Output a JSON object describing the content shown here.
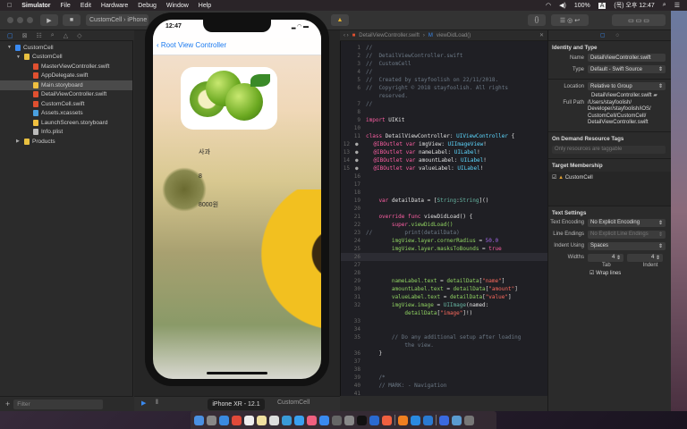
{
  "menubar": {
    "app": "Simulator",
    "items": [
      "File",
      "Edit",
      "Hardware",
      "Debug",
      "Window",
      "Help"
    ],
    "battery": "100%",
    "input_source": "A",
    "clock": "(목) 오후 12:47"
  },
  "toolbar": {
    "scheme": "CustomCell",
    "device": "iPhone"
  },
  "navigator": {
    "items": [
      {
        "label": "CustomCell",
        "icon": "project-icon",
        "indent": 0,
        "disclosure": "▼"
      },
      {
        "label": "CustomCell",
        "icon": "folder-icon",
        "indent": 1,
        "disclosure": "▼"
      },
      {
        "label": "MasterViewController.swift",
        "icon": "swift-file-icon",
        "indent": 2
      },
      {
        "label": "AppDelegate.swift",
        "icon": "swift-file-icon",
        "indent": 2
      },
      {
        "label": "Main.storyboard",
        "icon": "storyboard-icon",
        "indent": 2,
        "selected": true
      },
      {
        "label": "DetailViewController.swift",
        "icon": "swift-file-icon",
        "indent": 2
      },
      {
        "label": "CustomCell.swift",
        "icon": "swift-file-icon",
        "indent": 2
      },
      {
        "label": "Assets.xcassets",
        "icon": "assets-icon",
        "indent": 2
      },
      {
        "label": "LaunchScreen.storyboard",
        "icon": "storyboard-icon",
        "indent": 2
      },
      {
        "label": "Info.plist",
        "icon": "plist-icon",
        "indent": 2
      },
      {
        "label": "Products",
        "icon": "folder-icon",
        "indent": 1,
        "disclosure": "▶"
      }
    ],
    "filter_placeholder": "Filter"
  },
  "jumpbar": {
    "file": "DetailViewController.swift",
    "method": "viewDidLoad()"
  },
  "editor": {
    "lines": [
      {
        "n": "1",
        "s": [
          [
            "// ",
            "cm"
          ]
        ]
      },
      {
        "n": "2",
        "s": [
          [
            "//  DetailViewController.swift",
            "cm"
          ]
        ]
      },
      {
        "n": "3",
        "s": [
          [
            "//  CustomCell",
            "cm"
          ]
        ]
      },
      {
        "n": "4",
        "s": [
          [
            "//",
            "cm"
          ]
        ]
      },
      {
        "n": "5",
        "s": [
          [
            "//  Created by stayfoolish on 22/11/2018.",
            "cm"
          ]
        ]
      },
      {
        "n": "6",
        "s": [
          [
            "//  Copyright © 2018 stayfoolish. All rights",
            "cm"
          ]
        ]
      },
      {
        "n": "",
        "s": [
          [
            "    reserved.",
            "cm"
          ]
        ]
      },
      {
        "n": "7",
        "s": [
          [
            "//",
            "cm"
          ]
        ]
      },
      {
        "n": "8",
        "s": []
      },
      {
        "n": "9",
        "s": [
          [
            "import",
            "kw"
          ],
          [
            " UIKit",
            "pl"
          ]
        ]
      },
      {
        "n": "10",
        "s": []
      },
      {
        "n": "11",
        "s": [
          [
            "class",
            "kw"
          ],
          [
            " DetailViewController: ",
            "pl"
          ],
          [
            "UIViewController",
            "ty"
          ],
          [
            " {",
            "pl"
          ]
        ]
      },
      {
        "n": "12",
        "g": "●",
        "s": [
          [
            "    @IBOutlet",
            "kw"
          ],
          [
            " var",
            "kw"
          ],
          [
            " imgView: ",
            "pl"
          ],
          [
            "UIImageView",
            "ty"
          ],
          [
            "!",
            "pl"
          ]
        ]
      },
      {
        "n": "13",
        "g": "●",
        "s": [
          [
            "    @IBOutlet",
            "kw"
          ],
          [
            " var",
            "kw"
          ],
          [
            " nameLabel: ",
            "pl"
          ],
          [
            "UILabel",
            "ty"
          ],
          [
            "!",
            "pl"
          ]
        ]
      },
      {
        "n": "14",
        "g": "●",
        "s": [
          [
            "    @IBOutlet",
            "kw"
          ],
          [
            " var",
            "kw"
          ],
          [
            " amountLabel: ",
            "pl"
          ],
          [
            "UILabel",
            "ty"
          ],
          [
            "!",
            "pl"
          ]
        ]
      },
      {
        "n": "15",
        "g": "●",
        "s": [
          [
            "    @IBOutlet",
            "kw"
          ],
          [
            " var",
            "kw"
          ],
          [
            " valueLabel: ",
            "pl"
          ],
          [
            "UILabel",
            "ty"
          ],
          [
            "!",
            "pl"
          ]
        ]
      },
      {
        "n": "16",
        "s": []
      },
      {
        "n": "17",
        "s": []
      },
      {
        "n": "18",
        "s": []
      },
      {
        "n": "19",
        "s": [
          [
            "    var",
            "kw"
          ],
          [
            " detailData = [",
            "pl"
          ],
          [
            "String",
            "ty2"
          ],
          [
            ":",
            "pl"
          ],
          [
            "String",
            "ty2"
          ],
          [
            "]()",
            "pl"
          ]
        ]
      },
      {
        "n": "20",
        "s": []
      },
      {
        "n": "21",
        "s": [
          [
            "    override",
            "kw"
          ],
          [
            " func",
            "kw"
          ],
          [
            " viewDidLoad() {",
            "pl"
          ]
        ]
      },
      {
        "n": "22",
        "s": [
          [
            "        super",
            "kw"
          ],
          [
            ".viewDidLoad()",
            "pr"
          ]
        ]
      },
      {
        "n": "23",
        "s": [
          [
            "//          print(detailData)",
            "cm"
          ]
        ]
      },
      {
        "n": "24",
        "s": [
          [
            "        imgView.layer.cornerRadius",
            "pr"
          ],
          [
            " = ",
            "pl"
          ],
          [
            "50.0",
            "fn"
          ]
        ]
      },
      {
        "n": "25",
        "s": [
          [
            "        imgView.layer.masksToBounds",
            "pr"
          ],
          [
            " = ",
            "pl"
          ],
          [
            "true",
            "kw"
          ]
        ]
      },
      {
        "n": "26",
        "hl": true,
        "s": []
      },
      {
        "n": "27",
        "s": []
      },
      {
        "n": "28",
        "s": []
      },
      {
        "n": "29",
        "s": [
          [
            "        nameLabel.text",
            "pr"
          ],
          [
            " = ",
            "pl"
          ],
          [
            "detailData",
            "pr"
          ],
          [
            "[",
            "pl"
          ],
          [
            "\"name\"",
            "st"
          ],
          [
            "]",
            "pl"
          ]
        ]
      },
      {
        "n": "30",
        "s": [
          [
            "        amountLabel.text",
            "pr"
          ],
          [
            " = ",
            "pl"
          ],
          [
            "detailData",
            "pr"
          ],
          [
            "[",
            "pl"
          ],
          [
            "\"amount\"",
            "st"
          ],
          [
            "]",
            "pl"
          ]
        ]
      },
      {
        "n": "31",
        "s": [
          [
            "        valueLabel.text",
            "pr"
          ],
          [
            " = ",
            "pl"
          ],
          [
            "detailData",
            "pr"
          ],
          [
            "[",
            "pl"
          ],
          [
            "\"value\"",
            "st"
          ],
          [
            "]",
            "pl"
          ]
        ]
      },
      {
        "n": "32",
        "s": [
          [
            "        imgView.image",
            "pr"
          ],
          [
            " = ",
            "pl"
          ],
          [
            "UIImage",
            "ty2"
          ],
          [
            "(named:",
            "pl"
          ]
        ]
      },
      {
        "n": "",
        "s": [
          [
            "            detailData",
            "pr"
          ],
          [
            "[",
            "pl"
          ],
          [
            "\"image\"",
            "st"
          ],
          [
            "]!)",
            "pl"
          ]
        ]
      },
      {
        "n": "33",
        "s": []
      },
      {
        "n": "34",
        "s": []
      },
      {
        "n": "35",
        "s": [
          [
            "        // Do any additional setup after loading",
            "cm"
          ]
        ]
      },
      {
        "n": "",
        "s": [
          [
            "            the view.",
            "cm"
          ]
        ]
      },
      {
        "n": "36",
        "s": [
          [
            "    }",
            "pl"
          ]
        ]
      },
      {
        "n": "37",
        "s": []
      },
      {
        "n": "38",
        "s": []
      },
      {
        "n": "39",
        "s": [
          [
            "    /*",
            "cm"
          ]
        ]
      },
      {
        "n": "40",
        "s": [
          [
            "    // MARK: - Navigation",
            "cm"
          ]
        ]
      },
      {
        "n": "41",
        "s": []
      }
    ]
  },
  "inspector": {
    "identity_title": "Identity and Type",
    "name_label": "Name",
    "name_value": "DetailViewController.swift",
    "type_label": "Type",
    "type_value": "Default - Swift Source",
    "location_label": "Location",
    "location_value": "Relative to Group",
    "location_file": "DetailViewController.swift",
    "fullpath_label": "Full Path",
    "fullpath_value": [
      "/Users/stayfoolish/",
      "Developer/stayfoolish/iOS/",
      "CustomCell/CustomCell/",
      "DetailViewController.swift"
    ],
    "odr_title": "On Demand Resource Tags",
    "odr_placeholder": "Only resources are taggable",
    "target_title": "Target Membership",
    "target_name": "CustomCell",
    "text_title": "Text Settings",
    "encoding_label": "Text Encoding",
    "encoding_value": "No Explicit Encoding",
    "line_label": "Line Endings",
    "line_value": "No Explicit Line Endings",
    "indent_label": "Indent Using",
    "indent_value": "Spaces",
    "widths_label": "Widths",
    "tab_value": "4",
    "indent_width_value": "4",
    "tab_label": "Tab",
    "indent_sub_label": "Indent",
    "wrap_label": "Wrap lines"
  },
  "simulator": {
    "time": "12:47",
    "back_label": "Root View Controller",
    "name": "사과",
    "amount": "8",
    "value": "8000원"
  },
  "status": {
    "device_tooltip": "iPhone XR - 12.1",
    "scheme_tail": "CustomCell"
  },
  "dock": {
    "colors": [
      "#4a90e2",
      "#888",
      "#3a8ae0",
      "#e04a3a",
      "#eee",
      "#f0e0a0",
      "#ddd",
      "#3a9ad8",
      "#3aa0f0",
      "#f06080",
      "#3a8af0",
      "#666",
      "#888",
      "#111",
      "#2a6ad0",
      "#f06040",
      "#f08020",
      "#2a8ae0",
      "#2a7ad0",
      "#3a6ae0",
      "#5a9ad0",
      "#777"
    ]
  }
}
